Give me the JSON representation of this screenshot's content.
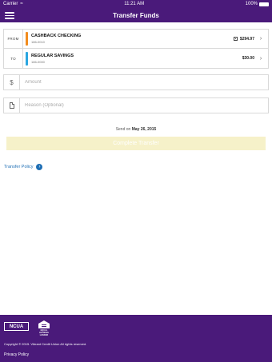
{
  "status_bar": {
    "carrier": "Carrier",
    "time": "11:21 AM",
    "battery": "100%"
  },
  "header": {
    "title": "Transfer Funds",
    "menu_icon": "hamburger-menu-icon"
  },
  "transfer": {
    "from": {
      "label": "FROM",
      "account_name": "CASHBACK CHECKING",
      "account_number": "186-0010",
      "balance": "$294.97",
      "color": "#f28c1e"
    },
    "to": {
      "label": "TO",
      "account_name": "REGULAR SAVINGS",
      "account_number": "186-0000",
      "balance": "$30.00",
      "color": "#2aa6e0"
    }
  },
  "amount": {
    "icon": "$",
    "placeholder": "Amount"
  },
  "reason": {
    "placeholder": "Reason (Optional)"
  },
  "send_on": {
    "prefix": "Send on",
    "date": "May 26, 2015"
  },
  "complete_button": {
    "label": "Complete Transfer"
  },
  "transfer_policy": {
    "label": "Transfer Policy"
  },
  "footer": {
    "ncua_label": "NCUA",
    "equal_housing_label": "EQUAL HOUSING LENDER",
    "copyright": "Copyright © 2015. Vibrant Credit Union All rights reserved.",
    "privacy_policy": "Privacy Policy"
  },
  "colors": {
    "brand_purple": "#4a1a7a",
    "link_blue": "#1f6fb5",
    "button_disabled": "#f6f1c9"
  }
}
